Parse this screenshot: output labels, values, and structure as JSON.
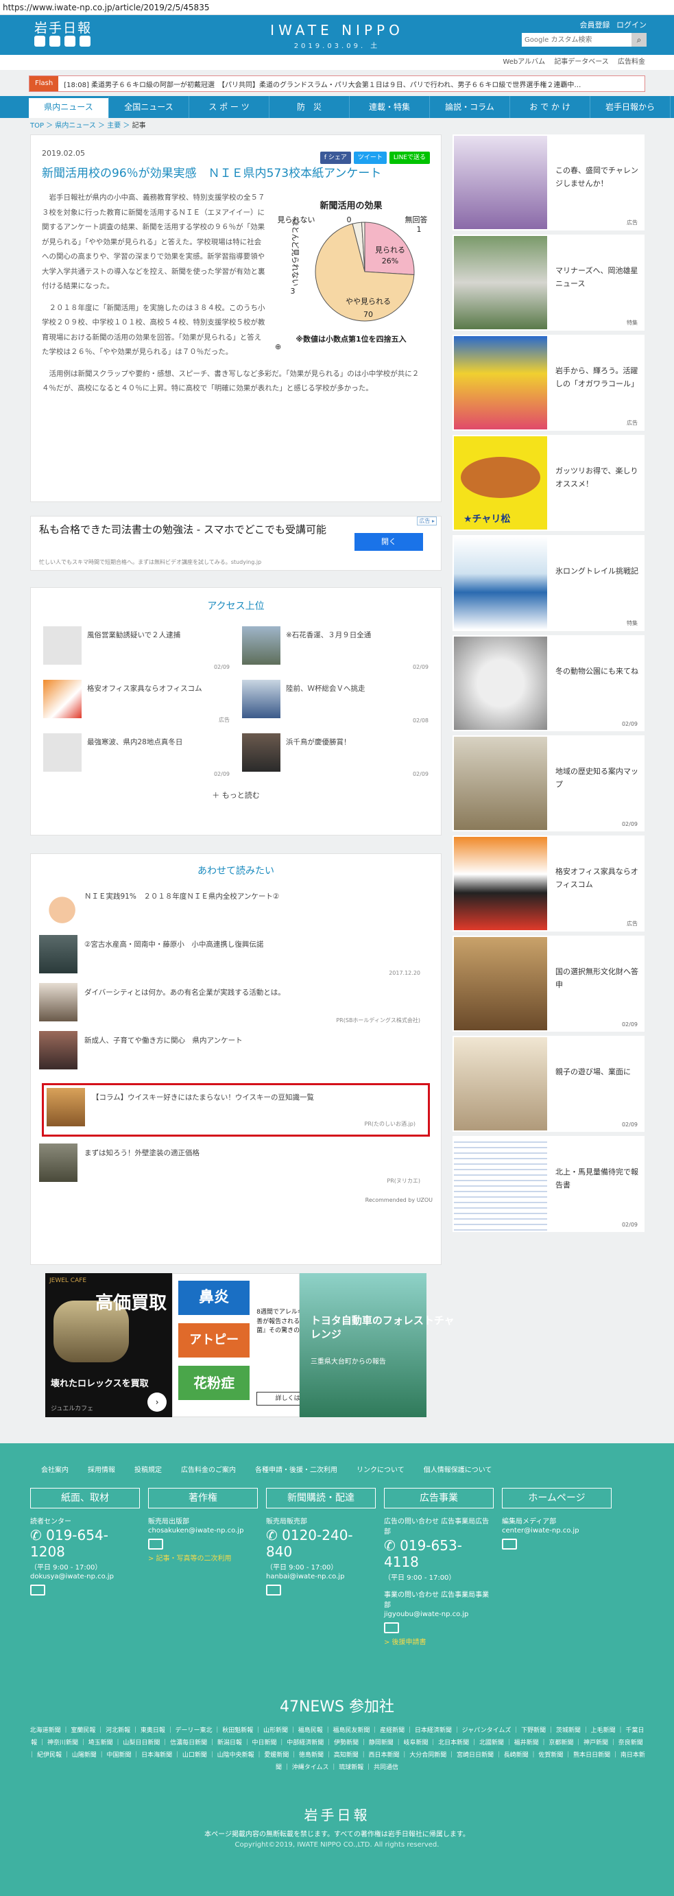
{
  "url": "https://www.iwate-np.co.jp/article/2019/2/5/45835",
  "header": {
    "logo": "岩手日報",
    "center_logo": "IWATE NIPPO",
    "center_date": "2019.03.09. 土",
    "member": "会員登録",
    "login": "ログイン",
    "search_placeholder": "Google カスタム検索"
  },
  "subnav": [
    "Webアルバム",
    "記事データベース",
    "広告料金"
  ],
  "flash": {
    "tag": "Flash",
    "text": "[18:08] 柔道男子６６キロ級の阿部一が初戴冠選　【パリ共同】柔道のグランドスラム・パリ大会第１日は９日、パリで行われ、男子６６キロ級で世界選手権２連覇中…"
  },
  "gnav": [
    "県内ニュース",
    "全国ニュース",
    "ス ポ ー ツ",
    "防　災",
    "連載・特集",
    "論説・コラム",
    "お で か け",
    "岩手日報から"
  ],
  "breadcrumb": {
    "top": "TOP",
    "news": "県内ニュース",
    "main": "主要",
    "current": "記事"
  },
  "article": {
    "date": "2019.02.05",
    "share": [
      "f シェア",
      "ツイート",
      "LINEで送る"
    ],
    "title": "新聞活用校の96％が効果実感　ＮＩＥ県内573校本紙アンケート",
    "p1": "岩手日報社が県内の小中高、義務教育学校、特別支援学校の全５７３校を対象に行った教育に新聞を活用するＮＩＥ（エヌアイイー）に関するアンケート調査の結果、新聞を活用する学校の９６％が「効果が見られる」「やや効果が見られる」と答えた。学校現場は特に社会への関心の高まりや、学習の深まりで効果を実感。新学習指導要領や大学入学共通テストの導入などを控え、新聞を使った学習が有効と裏付ける結果になった。",
    "p2": "２０１８年度に「新聞活用」を実施したのは３８４校。このうち小学校２０９校、中学校１０１校、高校５４校、特別支援学校５校が教育現場における新聞の活用の効果を回答。「効果が見られる」と答えた学校は２６％、「やや効果が見られる」は７０％だった。",
    "p3": "活用例は新聞スクラップや要約・感想、スピーチ、書き写しなど多彩だ。「効果が見られる」のは小中学校が共に２４％だが、高校になると４０％に上昇。特に高校で「明確に効果が表れた」と感じる学校が多かった。"
  },
  "chart_data": {
    "type": "pie",
    "title": "新聞活用の効果",
    "categories": [
      "見られる",
      "やや見られる",
      "ほとんど見られない",
      "見られない",
      "無回答"
    ],
    "values": [
      26,
      70,
      3,
      0,
      1
    ],
    "note": "※数値は小数点第1位を四捨五入",
    "colors": [
      "#f4b6c6",
      "#f6d7a4",
      "#f2efe4",
      "#f2efe4",
      "#f2efe4"
    ]
  },
  "ad1": {
    "title": "私も合格できた司法書士の勉強法 - スマホでどこでも受講可能",
    "sub": "忙しい人でもスキマ時間で短期合格へ。まずは無料ビデオ講座を試してみる。studying.jp",
    "button": "開く",
    "label": "広告 ▸"
  },
  "ranking": {
    "title": "アクセス上位",
    "items": [
      {
        "t": "風俗営業勧誘疑いで２人逮捕",
        "d": "02/09"
      },
      {
        "t": "※石花香運、３月９日全通",
        "d": "02/09"
      },
      {
        "t": "格安オフィス家具ならオフィスコム",
        "d": "広告"
      },
      {
        "t": "陸前、Ｗ杯総会Ｖへ挑走",
        "d": "02/08"
      },
      {
        "t": "最強寒波、県内28地点真冬日",
        "d": "02/09"
      },
      {
        "t": "浜千鳥が慶優勝賞！",
        "d": "02/09"
      }
    ],
    "more": "もっと読む"
  },
  "also": {
    "title": "あわせて読みたい",
    "items": [
      {
        "t": "ＮＩＥ実践91%　２０１８年度ＮＩＥ県内全校アンケート②",
        "d": ""
      },
      {
        "t": "②宮古水産高・岡南中・藤原小　小中高連携し復興伝諾",
        "d": "2017.12.20"
      },
      {
        "t": "ダイバーシティとは何か。あの有名企業が実践する活動とは。",
        "d": "PR(SBホールディングス株式会社)"
      },
      {
        "t": "新成人、子育てや働き方に関心　県内アンケート",
        "d": ""
      },
      {
        "t": "【コラム】ウイスキー好きにはたまらない！ウイスキーの豆知識一覧",
        "d": "PR(たのしいお酒.jp)"
      },
      {
        "t": "まずは知ろう！外壁塗装の適正価格",
        "d": "PR(ヌリカエ)"
      }
    ],
    "recommended": "Recommended by UZOU"
  },
  "bottom_ads": [
    {
      "title": "高価買取",
      "sub": "壊れたロレックスを買取",
      "brand": "ジュエルカフェ"
    },
    {
      "l1": "鼻炎",
      "l2": "アトピー",
      "l3": "花粉症",
      "r": "8週間でアレルギー症状の改善が報告される特別な『乳酸菌』その驚きの働きとは？",
      "btn": "詳しくはこちら"
    },
    {
      "t": "トヨタ自動車のフォレストチャレンジ",
      "s": "三重県大台町からの報告"
    }
  ],
  "sidebar": [
    {
      "t": "この春、盛岡でチャレンジしませんか！",
      "m": "広告"
    },
    {
      "t": "マリナーズへ、岡池雄星ニュース",
      "m": "特集"
    },
    {
      "t": "岩手から、輝ろう。活躍しの「オガワラコール」",
      "m": "広告"
    },
    {
      "t": "ガッツリお得で、楽しりオススメ！",
      "m": ""
    },
    {
      "t": "氷ロングトレイル挑戦記",
      "m": "特集"
    },
    {
      "t": "冬の動物公園にも来てね",
      "m": "02/09"
    },
    {
      "t": "地域の歴史知る案内マップ",
      "m": "02/09"
    },
    {
      "t": "格安オフィス家具ならオフィスコム",
      "m": "広告"
    },
    {
      "t": "国の選択無形文化財へ答申",
      "m": "02/09"
    },
    {
      "t": "親子の遊び場、業面に",
      "m": "02/09"
    },
    {
      "t": "北上・馬見量備待完で報告書",
      "m": "02/09"
    }
  ],
  "footer": {
    "links": [
      "会社案内",
      "採用情報",
      "投稿規定",
      "広告料金のご案内",
      "各種申請・後援・二次利用",
      "リンクについて",
      "個人情報保護について"
    ],
    "cols": [
      {
        "h": "紙面、取材",
        "s": "読者センター",
        "tel": "019-654-1208",
        "m": "（平日 9:00 - 17:00）",
        "mail": "dokusya@iwate-np.co.jp"
      },
      {
        "h": "著作権",
        "s": "販売局出版部",
        "mail": "chosakuken@iwate-np.co.jp",
        "y": "> 記事・写真等の二次利用"
      },
      {
        "h": "新聞購読・配達",
        "s": "販売局販売部",
        "tel": "0120-240-840",
        "m": "（平日 9:00 - 17:00）",
        "mail": "hanbai@iwate-np.co.jp"
      },
      {
        "h": "広告事業",
        "s": "広告の問い合わせ 広告事業局広告部",
        "tel": "019-653-4118",
        "m": "（平日 9:00 - 17:00）",
        "s2": "事業の問い合わせ 広告事業局事業部",
        "mail": "jigyoubu@iwate-np.co.jp",
        "y": "> 後援申請書"
      },
      {
        "h": "ホームページ",
        "s": "編集局メディア部",
        "mail": "center@iwate-np.co.jp"
      }
    ],
    "news47": "47NEWS 参加社",
    "papers": "北海道新聞 ｜ 室蘭民報 ｜ 河北新報 ｜ 東奥日報 ｜ デーリー東北 ｜ 秋田魁新報 ｜ 山形新聞 ｜ 福島民報 ｜ 福島民友新聞 ｜ 産経新聞 ｜ 日本経済新聞 ｜ ジャパンタイムズ ｜ 下野新聞 ｜ 茨城新聞 ｜ 上毛新聞 ｜ 千葉日報 ｜ 神奈川新聞 ｜ 埼玉新聞 ｜ 山梨日日新聞 ｜ 信濃毎日新聞 ｜ 新潟日報 ｜ 中日新聞 ｜ 中部経済新聞 ｜ 伊勢新聞 ｜ 静岡新聞 ｜ 岐阜新聞 ｜ 北日本新聞 ｜ 北國新聞 ｜ 福井新聞 ｜ 京都新聞 ｜ 神戸新聞 ｜ 奈良新聞 ｜ 紀伊民報 ｜ 山陽新聞 ｜ 中国新聞 ｜ 日本海新聞 ｜ 山口新聞 ｜ 山陰中央新報 ｜ 愛媛新聞 ｜ 徳島新聞 ｜ 高知新聞 ｜ 西日本新聞 ｜ 大分合同新聞 ｜ 宮崎日日新聞 ｜ 長崎新聞 ｜ 佐賀新聞 ｜ 熊本日日新聞 ｜ 南日本新聞 ｜ 沖縄タイムス ｜ 琉球新報 ｜ 共同通信",
    "logo": "岩手日報",
    "note": "本ページ掲載内容の無断転載を禁じます。すべての著作権は岩手日報社に帰属します。",
    "copy": "Copyright©2019, IWATE NIPPO CO.,LTD. All rights reserved."
  }
}
